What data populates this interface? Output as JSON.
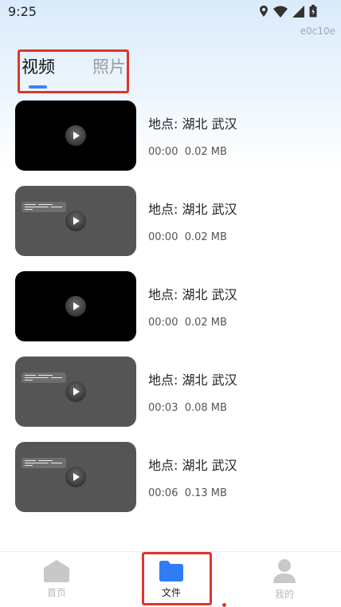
{
  "status_bar": {
    "time": "9:25",
    "watermark": "e0c10e"
  },
  "tabs": {
    "video_label": "视频",
    "photo_label": "照片",
    "active": "视频"
  },
  "videos": [
    {
      "location": "地点: 湖北 武汉",
      "duration": "00:00",
      "size": "0.02 MB",
      "thumb": "dark"
    },
    {
      "location": "地点: 湖北 武汉",
      "duration": "00:00",
      "size": "0.02 MB",
      "thumb": "grey"
    },
    {
      "location": "地点: 湖北 武汉",
      "duration": "00:00",
      "size": "0.02 MB",
      "thumb": "dark"
    },
    {
      "location": "地点: 湖北 武汉",
      "duration": "00:03",
      "size": "0.08 MB",
      "thumb": "grey"
    },
    {
      "location": "地点: 湖北 武汉",
      "duration": "00:06",
      "size": "0.13 MB",
      "thumb": "grey"
    }
  ],
  "bottom_nav": {
    "home_label": "首页",
    "file_label": "文件",
    "mine_label": "我的",
    "active": "文件",
    "accent_color": "#2f7cf6",
    "inactive_color": "#c8c8c8"
  },
  "icons": {
    "status": [
      "location-icon",
      "wifi-icon",
      "signal-icon",
      "battery-icon"
    ],
    "nav": [
      "home-icon",
      "folder-icon",
      "person-icon"
    ]
  }
}
